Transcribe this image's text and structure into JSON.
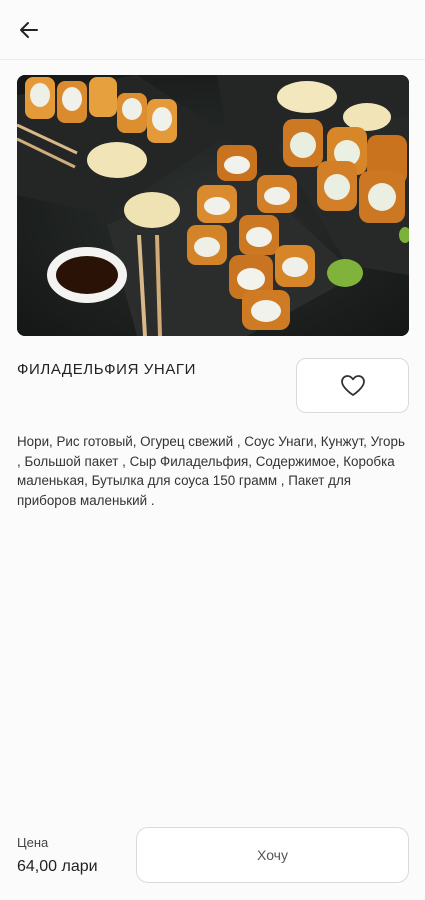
{
  "header": {
    "back_icon": "arrow-left-icon"
  },
  "product": {
    "title": "ФИЛАДЕЛЬФИЯ УНАГИ",
    "description": "Нори, Рис готовый, Огурец свежий , Соус Унаги, Кунжут, Угорь , Большой пакет , Сыр Филадельфия, Содержимое, Коробка маленькая, Бутылка для соуса 150 грамм , Пакет для приборов маленький .",
    "favorite_icon": "heart-outline-icon",
    "image_icon": "sushi-photo"
  },
  "footer": {
    "price_label": "Цена",
    "price_value": "64,00 лари",
    "want_button": "Хочу"
  }
}
